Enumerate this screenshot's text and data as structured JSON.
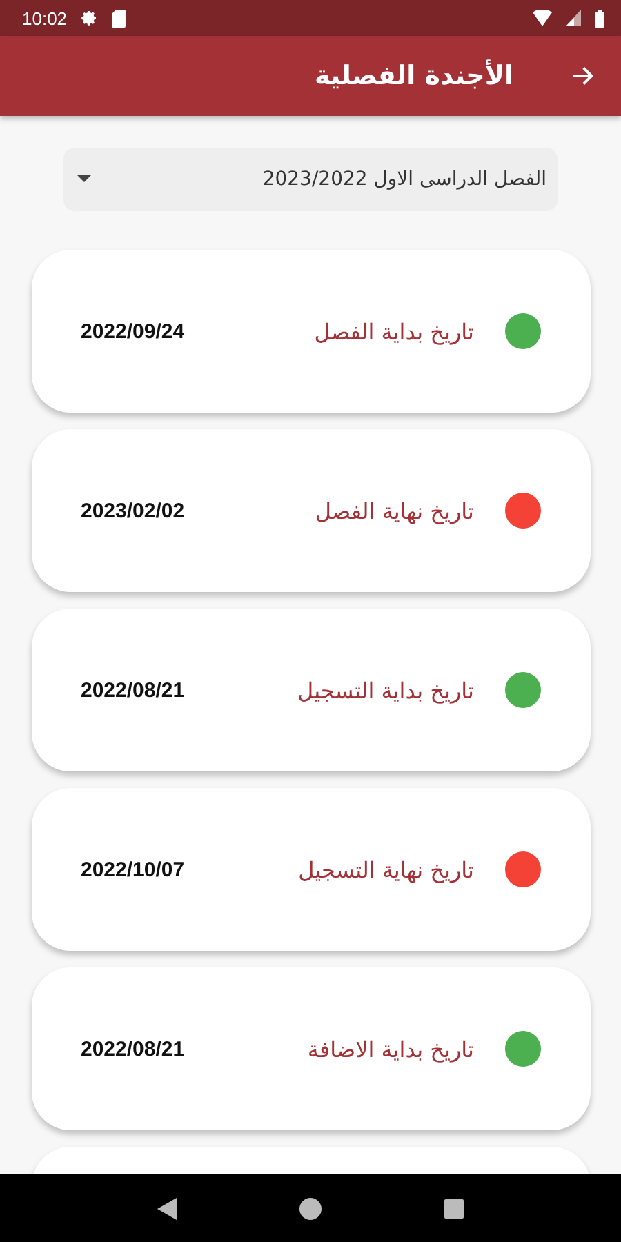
{
  "status_bar": {
    "time": "10:02"
  },
  "app_bar": {
    "title": "الأجندة الفصلية"
  },
  "semester_dropdown": {
    "value": "الفصل الدراسى الاول 2023/2022"
  },
  "events": [
    {
      "label": "تاريخ بداية الفصل",
      "date": "2022/09/24",
      "color": "#4caf50"
    },
    {
      "label": "تاريخ نهاية الفصل",
      "date": "2023/02/02",
      "color": "#f44336"
    },
    {
      "label": "تاريخ بداية التسجيل",
      "date": "2022/08/21",
      "color": "#4caf50"
    },
    {
      "label": "تاريخ نهاية التسجيل",
      "date": "2022/10/07",
      "color": "#f44336"
    },
    {
      "label": "تاريخ بداية الاضافة",
      "date": "2022/08/21",
      "color": "#4caf50"
    }
  ]
}
